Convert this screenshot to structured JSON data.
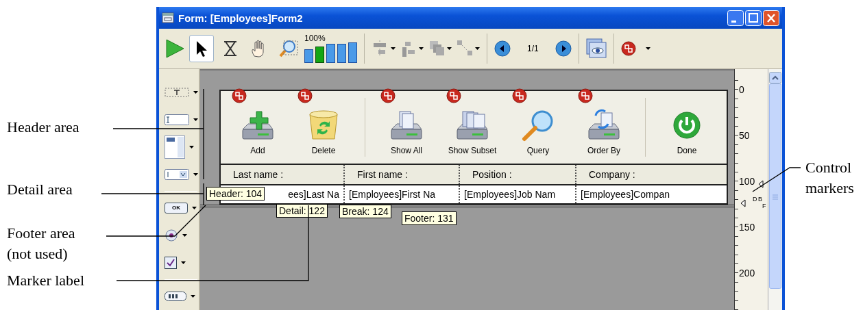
{
  "window": {
    "title": "Form: [Employees]Form2"
  },
  "toolbar": {
    "tools": [
      {
        "kind": "pointer",
        "selected": true
      },
      {
        "kind": "sequence",
        "selected": false
      },
      {
        "kind": "hand",
        "selected": false
      },
      {
        "kind": "zoom",
        "selected": false
      }
    ],
    "zoom": "100%",
    "zoom_levels": [
      {
        "selected": false
      },
      {
        "selected": true
      },
      {
        "selected": false
      },
      {
        "selected": false
      },
      {
        "selected": false
      }
    ],
    "page": "1/1"
  },
  "form": {
    "buttons": [
      {
        "label": "Add",
        "kind": "add",
        "badge": true
      },
      {
        "label": "Delete",
        "kind": "delete",
        "badge": true,
        "separator_after": true
      },
      {
        "label": "Show All",
        "kind": "show_all",
        "badge": true
      },
      {
        "label": "Show Subset",
        "kind": "show_subset",
        "badge": true
      },
      {
        "label": "Query",
        "kind": "query",
        "badge": true
      },
      {
        "label": "Order By",
        "kind": "order_by",
        "badge": true,
        "separator_after": true
      },
      {
        "label": "Done",
        "kind": "done",
        "badge": false
      }
    ],
    "columns": [
      "Last name :",
      "First name :",
      "Position :",
      "Company :"
    ],
    "row": [
      "ees]Last Na",
      "[Employees]First Na",
      "[Employees]Job Nam",
      "[Employees]Compan"
    ],
    "markers": [
      {
        "label": "Header: 104"
      },
      {
        "label": "Detail: 122"
      },
      {
        "label": "Break: 124"
      },
      {
        "label": "Footer: 131"
      }
    ]
  },
  "palette": {
    "ok_label": "OK"
  },
  "ruler": {
    "ticks": [
      "0",
      "50",
      "100",
      "150",
      "200"
    ],
    "marker_letters": [
      "D",
      "B",
      "F"
    ]
  },
  "callouts": [
    {
      "text": "Header area"
    },
    {
      "text": "Detail area"
    },
    {
      "text": "Footer area (not used)"
    },
    {
      "text": "Marker label"
    },
    {
      "text": "Control markers"
    }
  ]
}
